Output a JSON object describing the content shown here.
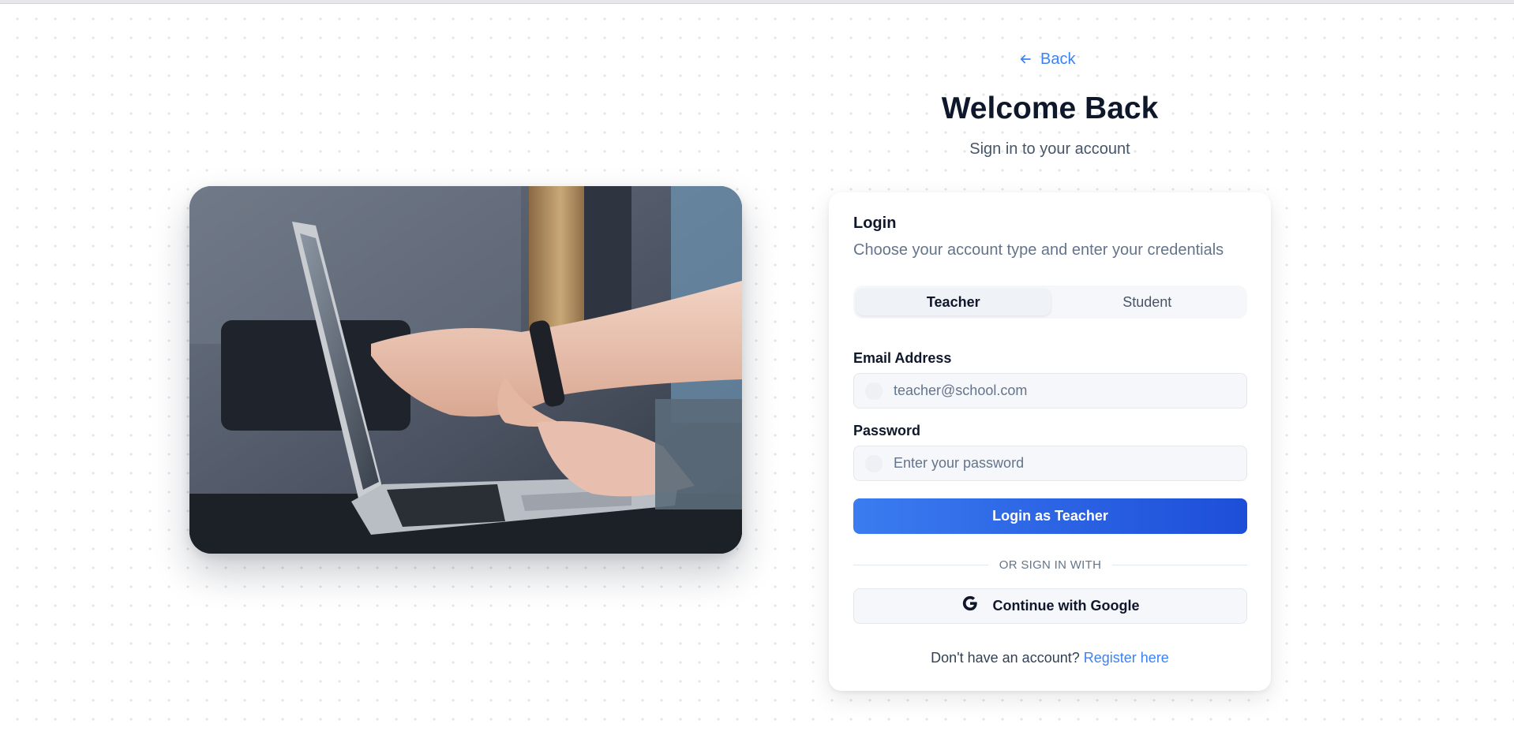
{
  "back": {
    "label": "Back",
    "icon": "arrow-left-icon"
  },
  "header": {
    "title": "Welcome Back",
    "subtitle": "Sign in to your account"
  },
  "hero": {
    "icon": "laptop-photo"
  },
  "card": {
    "title": "Login",
    "description": "Choose your account type and enter your credentials",
    "tabs": [
      {
        "label": "Teacher",
        "active": true
      },
      {
        "label": "Student",
        "active": false
      }
    ],
    "email": {
      "label": "Email Address",
      "placeholder": "teacher@school.com",
      "value": ""
    },
    "password": {
      "label": "Password",
      "placeholder": "Enter your password",
      "value": ""
    },
    "submit_label": "Login as Teacher",
    "divider_text": "OR SIGN IN WITH",
    "google": {
      "label": "Continue with Google",
      "icon": "google-icon"
    },
    "footer": {
      "prompt": "Don't have an account?",
      "link": "Register here"
    }
  },
  "colors": {
    "accent": "#3b82f6",
    "button_gradient_start": "#3b7cf0",
    "button_gradient_end": "#1d4ed8",
    "muted_text": "#64748b"
  }
}
